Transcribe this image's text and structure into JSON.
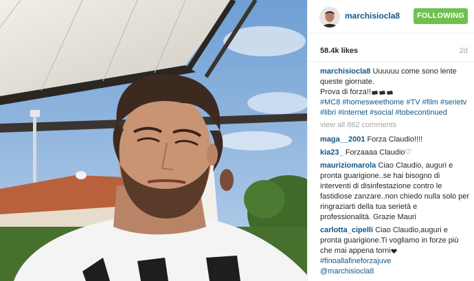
{
  "post": {
    "author": "marchisiocla8",
    "follow_label": "FOLLOWING",
    "likes": "58.4k likes",
    "age": "2d"
  },
  "caption": {
    "username": "marchisiocla8",
    "line1": "Uuuuuu come sono lente queste giornate.",
    "line2": "Prova di forza!!",
    "emoji": "fist-emoji-x3",
    "hashtags": [
      "#MC8",
      "#homesweethome",
      "#TV",
      "#film",
      "#serietv",
      "#libri",
      "#internet",
      "#social",
      "#tobecontinued"
    ]
  },
  "view_all": "view all 862 comments",
  "comments": [
    {
      "username": "maga__2001",
      "text": "Forza Claudio!!!!"
    },
    {
      "username": "kia23_",
      "text": "Forzaaaa Claudio♡"
    },
    {
      "username": "mauriziomarola",
      "text": "Ciao Claudio, auguri e pronta guarigione..se hai bisogno di interventi di disinfestazione contro le fastidiose zanzare..non chiedo nulla solo per ringraziarti della tua serietà e professionalità. Grazie Mauri"
    },
    {
      "username": "carlotta_cipelli",
      "text": "Ciao Claudio,auguri e pronta guarigione.Ti vogliamo in forze più che mai appena torni",
      "hashtag": "#finoallafineforzajuve",
      "mention": "@marchisiocla8"
    }
  ],
  "colors": {
    "link_blue": "#125688",
    "follow_green": "#70c050",
    "muted_gray": "#a5a7aa"
  }
}
